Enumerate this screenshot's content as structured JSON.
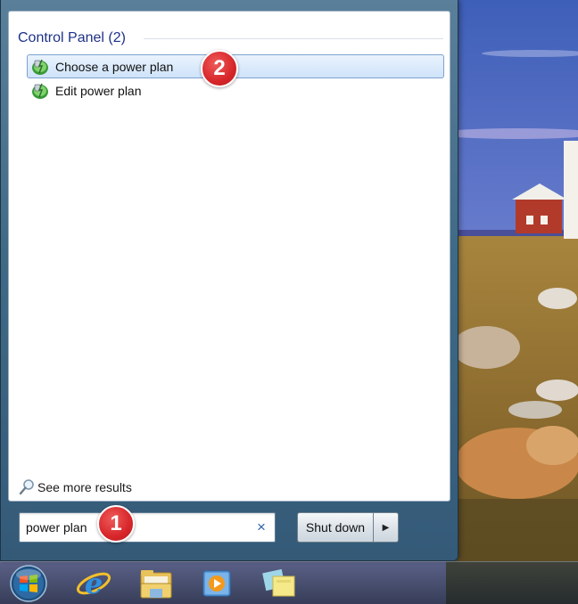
{
  "start_menu": {
    "group_header": "Control Panel (2)",
    "results": [
      {
        "label": "Choose a power plan",
        "icon": "power-options-icon",
        "selected": true
      },
      {
        "label": "Edit power plan",
        "icon": "power-options-icon",
        "selected": false
      }
    ],
    "see_more_label": "See more results",
    "search": {
      "value": "power plan",
      "clear_glyph": "×"
    },
    "shutdown_label": "Shut down",
    "shutdown_arrow_glyph": "▶"
  },
  "badges": {
    "step1": "1",
    "step2": "2"
  },
  "taskbar": {
    "items": [
      "start-orb-icon",
      "internet-explorer-icon",
      "windows-explorer-icon",
      "media-player-icon",
      "sticky-notes-icon"
    ]
  },
  "colors": {
    "header_text": "#1e3287",
    "selection_bg": "#cfe3fa",
    "badge": "#d7262a"
  }
}
